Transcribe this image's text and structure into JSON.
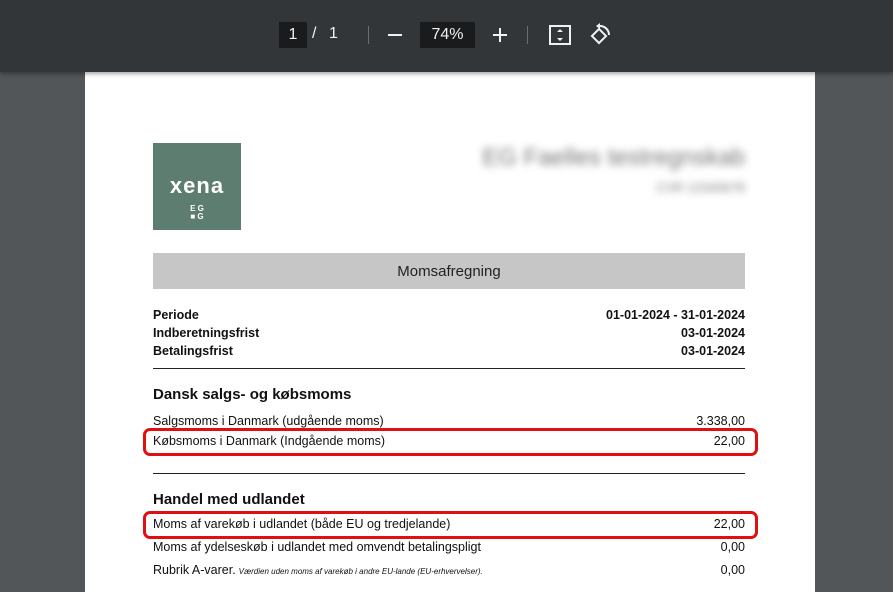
{
  "toolbar": {
    "current_page": "1",
    "separator": "/",
    "total_pages": "1",
    "zoom": "74%"
  },
  "logo": {
    "word": "xena",
    "sub_top": "E G",
    "sub_bottom": "■ G"
  },
  "company": {
    "name": "EG Faelles testregnskab",
    "cvr": "CVR 12345678"
  },
  "document": {
    "title": "Momsafregning",
    "header_rows": [
      {
        "label": "Periode",
        "value": "01-01-2024 - 31-01-2024"
      },
      {
        "label": "Indberetningsfrist",
        "value": "03-01-2024"
      },
      {
        "label": "Betalingsfrist",
        "value": "03-01-2024"
      }
    ],
    "section1": {
      "heading": "Dansk salgs- og købsmoms",
      "rows": [
        {
          "label": "Salgsmoms i Danmark (udgående moms)",
          "value": "3.338,00"
        },
        {
          "label": "Købsmoms i Danmark (Indgående moms)",
          "value": "22,00"
        }
      ]
    },
    "section2": {
      "heading": "Handel med udlandet",
      "rows": [
        {
          "label": "Moms af varekøb i udlandet (både EU og tredjelande)",
          "value": "22,00",
          "note": ""
        },
        {
          "label": "Moms af ydelseskøb i udlandet med omvendt betalingspligt",
          "value": "0,00",
          "note": ""
        },
        {
          "label": "Rubrik A-varer.",
          "value": "0,00",
          "note": "Værdien uden moms af varekøb i andre EU-lande (EU-erhvervelser)."
        }
      ]
    }
  },
  "colors": {
    "toolbar_bg": "#323639",
    "viewer_bg": "#525659",
    "logo_bg": "#5e7d71",
    "highlight": "#e01010"
  }
}
